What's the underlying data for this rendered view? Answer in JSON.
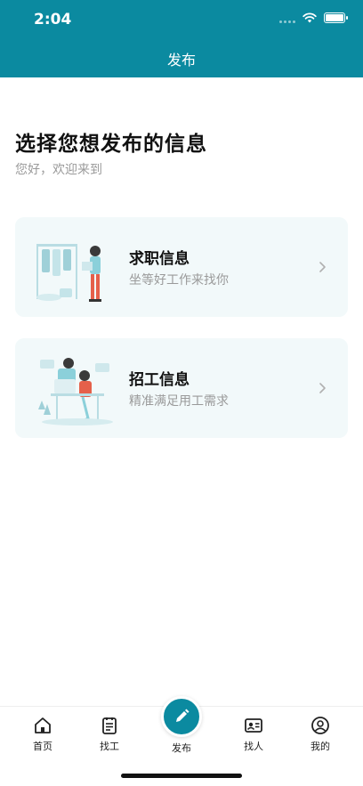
{
  "status_bar": {
    "time": "2:04"
  },
  "nav": {
    "title": "发布"
  },
  "page": {
    "title": "选择您想发布的信息",
    "subtitle": "您好，欢迎来到"
  },
  "cards": [
    {
      "title": "求职信息",
      "subtitle": "坐等好工作来找你",
      "icon": "job-seeker-illustration"
    },
    {
      "title": "招工信息",
      "subtitle": "精准满足用工需求",
      "icon": "recruiter-illustration"
    }
  ],
  "tabbar": {
    "items": [
      {
        "label": "首页",
        "icon": "home-icon"
      },
      {
        "label": "找工",
        "icon": "clipboard-icon"
      },
      {
        "label": "发布",
        "icon": "pencil-icon",
        "active": true
      },
      {
        "label": "找人",
        "icon": "id-card-icon"
      },
      {
        "label": "我的",
        "icon": "user-icon"
      }
    ]
  },
  "colors": {
    "brand": "#0b8aa0",
    "card_bg": "#f2f9fa",
    "muted_text": "#9a9a9a"
  }
}
